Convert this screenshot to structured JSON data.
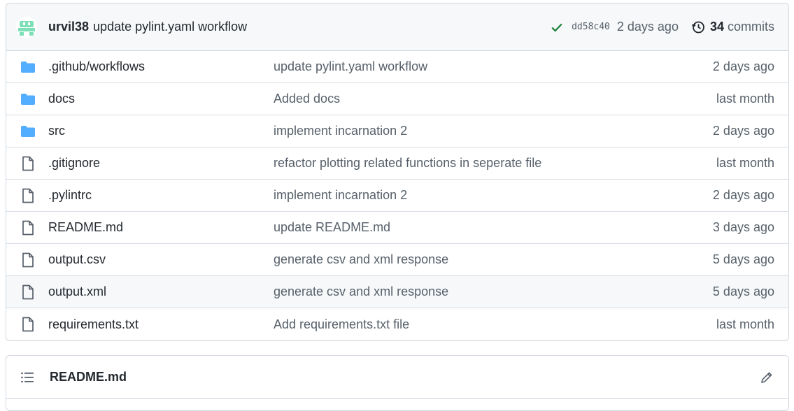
{
  "latest_commit": {
    "author": "urvil38",
    "message": "update pylint.yaml workflow",
    "sha": "dd58c40",
    "age": "2 days ago",
    "commits_count": "34",
    "commits_label": "commits",
    "status_color": "#1a7f37"
  },
  "files": [
    {
      "type": "folder",
      "name": ".github/workflows",
      "commit": "update pylint.yaml workflow",
      "age": "2 days ago"
    },
    {
      "type": "folder",
      "name": "docs",
      "commit": "Added docs",
      "age": "last month"
    },
    {
      "type": "folder",
      "name": "src",
      "commit": "implement incarnation 2",
      "age": "2 days ago"
    },
    {
      "type": "file",
      "name": ".gitignore",
      "commit": "refactor plotting related functions in seperate file",
      "age": "last month"
    },
    {
      "type": "file",
      "name": ".pylintrc",
      "commit": "implement incarnation 2",
      "age": "2 days ago"
    },
    {
      "type": "file",
      "name": "README.md",
      "commit": "update README.md",
      "age": "3 days ago"
    },
    {
      "type": "file",
      "name": "output.csv",
      "commit": "generate csv and xml response",
      "age": "5 days ago"
    },
    {
      "type": "file",
      "name": "output.xml",
      "commit": "generate csv and xml response",
      "age": "5 days ago"
    },
    {
      "type": "file",
      "name": "requirements.txt",
      "commit": "Add requirements.txt file",
      "age": "last month"
    }
  ],
  "readme": {
    "title": "README.md"
  },
  "colors": {
    "folder": "#54aeff",
    "file_icon": "#57606a",
    "avatar": "#7ee0b8"
  }
}
